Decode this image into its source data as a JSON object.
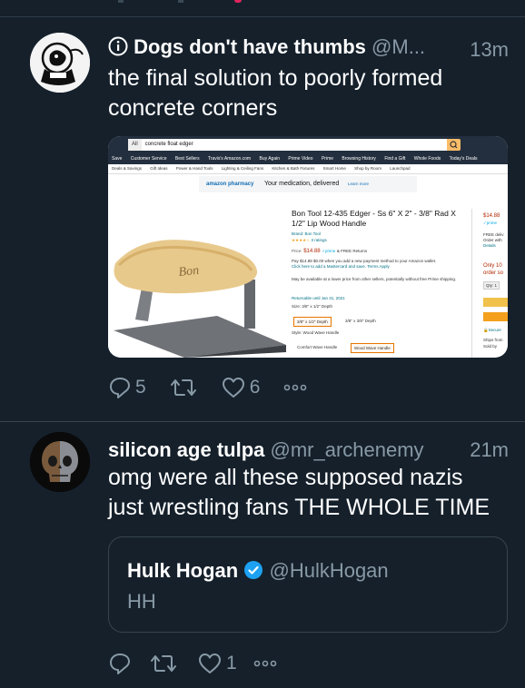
{
  "tweet1": {
    "prefix_icon": "info-circle-icon",
    "name": "Dogs don't have thumbs",
    "handle": "@M...",
    "time": "13m",
    "text_line1": "the final solution to poorly formed",
    "text_line2": "concrete corners",
    "media": {
      "search_category": "All",
      "search_query": "concrete float edger",
      "nav_items": [
        "Save",
        "Customer Service",
        "Best Sellers",
        "Travis's Amazon.com",
        "Buy Again",
        "Prime Video",
        "Prime",
        "Browsing History",
        "Find a Gift",
        "Whole Foods",
        "Today's Deals"
      ],
      "subnav_items": [
        "Deals & Savings",
        "Gift Ideas",
        "Power & Hand Tools",
        "Lighting & Ceiling Fans",
        "Kitchen & Bath Fixtures",
        "Smart Home",
        "Shop by Room",
        "Launchpad"
      ],
      "banner_brand": "amazon pharmacy",
      "banner_text": "Your medication, delivered",
      "banner_link": "Learn more",
      "product_title": "Bon Tool 12-435 Edger - Ss 6\" X 2\" - 3/8\" Rad X 1/2\" Lip Wood Handle",
      "brand": "Brand: Bon Tool",
      "ratings": "3 ratings",
      "price_label": "Price:",
      "price": "$14.88",
      "returns": "& FREE Returns",
      "pay_line": "Pay $14.88 $0.00 when you add a new payment method to your Amazon wallet.",
      "mastercard_line": "Click here to add a Mastercard and save. Terms Apply",
      "other_sellers": "May be available at a lower price from other sellers, potentially without free Prime shipping.",
      "returnable": "Returnable until Jan 31, 2021",
      "size_label": "Size: 3/8\" x 1/2\" Depth",
      "size_opt1": "3/8\" x 1/2\" Depth",
      "size_opt2": "3/8\" x 3/8\" Depth",
      "style_label": "Style: Wood Wave Handle",
      "style_opt1": "Comfort Wave Handle",
      "style_opt2": "Wood Wave Handle",
      "side_price": "$14.88",
      "side_free": "FREE deliv",
      "side_order": "Order with",
      "side_details": "Details",
      "side_only": "Only 10",
      "side_order_soon": "order so",
      "side_qty": "Qty: 1",
      "side_secure": "Secure",
      "side_ships": "Ships from",
      "side_sold": "Sold by",
      "handle_brand": "Bon"
    },
    "replies": "5",
    "likes": "6"
  },
  "tweet2": {
    "name": "silicon age tulpa",
    "handle": "@mr_archenemy",
    "time": "21m",
    "text_line1": "omg were all these supposed nazis",
    "text_line2": "just wrestling fans THE WHOLE TIME",
    "quote": {
      "name": "Hulk Hogan",
      "verified_icon": "verified-badge-icon",
      "handle": "@HulkHogan",
      "text": "HH"
    },
    "likes": "1"
  },
  "colors": {
    "background": "#15202b",
    "secondary_text": "#8899a6",
    "border": "#38444d",
    "verified": "#1da1f2"
  }
}
